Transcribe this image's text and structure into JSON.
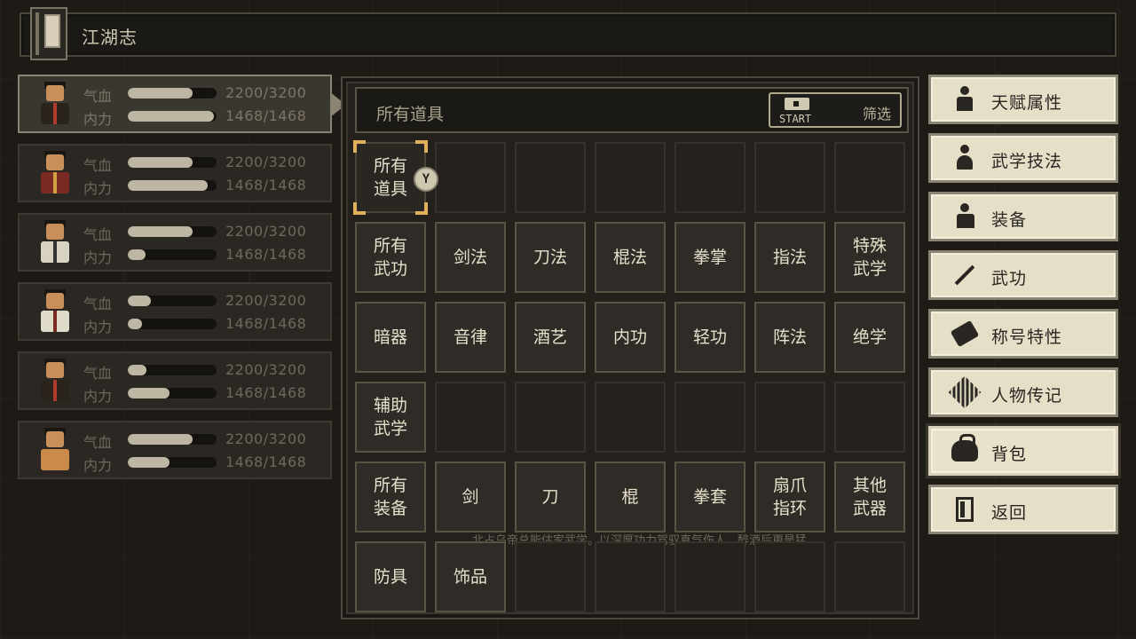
{
  "title": {
    "text": "江湖志",
    "icon": "book-icon"
  },
  "party": [
    {
      "portrait": "warrior-portrait",
      "hp_label": "气血",
      "hp_value": "2200/3200",
      "hp_fill": 0.73,
      "mp_label": "内力",
      "mp_value": "1468/1468",
      "mp_fill": 0.97,
      "active": true,
      "robe": "#2a241d",
      "sash": "#b03a2e"
    },
    {
      "portrait": "monk-portrait",
      "hp_label": "气血",
      "hp_value": "2200/3200",
      "hp_fill": 0.73,
      "mp_label": "内力",
      "mp_value": "1468/1468",
      "mp_fill": 0.9,
      "active": false,
      "robe": "#7a2a22",
      "sash": "#d0a040"
    },
    {
      "portrait": "scholar-portrait",
      "hp_label": "气血",
      "hp_value": "2200/3200",
      "hp_fill": 0.73,
      "mp_label": "内力",
      "mp_value": "1468/1468",
      "mp_fill": 0.2,
      "active": false,
      "robe": "#d8d2c0",
      "sash": "#333"
    },
    {
      "portrait": "elder-portrait",
      "hp_label": "气血",
      "hp_value": "2200/3200",
      "hp_fill": 0.26,
      "mp_label": "内力",
      "mp_value": "1468/1468",
      "mp_fill": 0.16,
      "active": false,
      "robe": "#e0dac8",
      "sash": "#7a2a22"
    },
    {
      "portrait": "fighter-portrait",
      "hp_label": "气血",
      "hp_value": "2200/3200",
      "hp_fill": 0.21,
      "mp_label": "内力",
      "mp_value": "1468/1468",
      "mp_fill": 0.47,
      "active": false,
      "robe": "#2a241d",
      "sash": "#b03a2e"
    },
    {
      "portrait": "dog-portrait",
      "hp_label": "气血",
      "hp_value": "2200/3200",
      "hp_fill": 0.73,
      "mp_label": "内力",
      "mp_value": "1468/1468",
      "mp_fill": 0.47,
      "active": false,
      "robe": "#c98a4a",
      "sash": "#c98a4a"
    }
  ],
  "inventory": {
    "filter_text": "所有道具",
    "filter_button": {
      "hint": "START",
      "label": "筛选"
    },
    "controller_hint": "Y",
    "bleed_text": "北占乌帝总能估家武学。以深厚功力驾驭真气伤人，醉酒后更是猛",
    "grid": [
      [
        "所有\n道具",
        "",
        "",
        "",
        "",
        "",
        ""
      ],
      [
        "所有\n武功",
        "剑法",
        "刀法",
        "棍法",
        "拳掌",
        "指法",
        "特殊\n武学"
      ],
      [
        "暗器",
        "音律",
        "酒艺",
        "内功",
        "轻功",
        "阵法",
        "绝学"
      ],
      [
        "辅助\n武学",
        "",
        "",
        "",
        "",
        "",
        ""
      ],
      [
        "所有\n装备",
        "剑",
        "刀",
        "棍",
        "拳套",
        "扇爪\n指环",
        "其他\n武器"
      ],
      [
        "防具",
        "饰品",
        "",
        "",
        "",
        "",
        ""
      ]
    ],
    "selected": "所有\n道具"
  },
  "menu": [
    {
      "label": "天赋属性",
      "icon": "person-icon",
      "active": false
    },
    {
      "label": "武学技法",
      "icon": "meditation-icon",
      "active": false
    },
    {
      "label": "装备",
      "icon": "armor-person-icon",
      "active": false
    },
    {
      "label": "武功",
      "icon": "sword-icon",
      "active": false
    },
    {
      "label": "称号特性",
      "icon": "tag-icon",
      "active": false
    },
    {
      "label": "人物传记",
      "icon": "scroll-icon",
      "active": false
    },
    {
      "label": "背包",
      "icon": "bag-icon",
      "active": true
    },
    {
      "label": "返回",
      "icon": "door-icon",
      "active": false
    }
  ]
}
